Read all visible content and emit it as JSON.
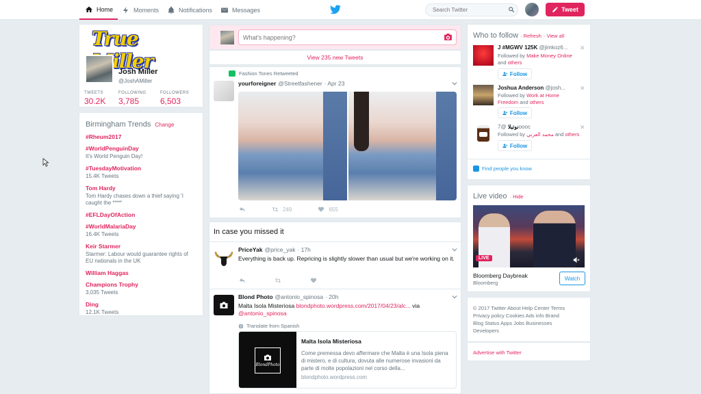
{
  "nav": {
    "home": "Home",
    "moments": "Moments",
    "notifications": "Notifications",
    "messages": "Messages",
    "search_placeholder": "Search Twitter",
    "tweet_button": "Tweet"
  },
  "profile": {
    "banner_logo": "True Miller",
    "name": "Josh Miller",
    "handle": "@JoshAMiller",
    "stats": [
      {
        "label": "TWEETS",
        "value": "30.2K"
      },
      {
        "label": "FOLLOWING",
        "value": "3,785"
      },
      {
        "label": "FOLLOWERS",
        "value": "6,503"
      }
    ]
  },
  "trends": {
    "title": "Birmingham Trends",
    "change": "Change",
    "items": [
      {
        "name": "#Rheum2017",
        "sub": ""
      },
      {
        "name": "#WorldPenguinDay",
        "sub": "It's World Penguin Day!"
      },
      {
        "name": "#TuesdayMotivation",
        "sub": "15.4K Tweets"
      },
      {
        "name": "Tom Hardy",
        "sub": "Tom Hardy chases down a thief saying 'I caught the ****'"
      },
      {
        "name": "#EFLDayOfAction",
        "sub": ""
      },
      {
        "name": "#WorldMalariaDay",
        "sub": "16.4K Tweets"
      },
      {
        "name": "Keir Starmer",
        "sub": "Starmer: Labour would guarantee rights of EU nationals in the UK"
      },
      {
        "name": "William Haggas",
        "sub": ""
      },
      {
        "name": "Champions Trophy",
        "sub": "3,035 Tweets"
      },
      {
        "name": "Ding",
        "sub": "12.1K Tweets"
      }
    ]
  },
  "compose": {
    "placeholder": "What's happening?"
  },
  "new_tweets": "View 235 new Tweets",
  "tweet1": {
    "context": "Fashion Tones Retweeted",
    "name": "yourforeigner",
    "handle": "@Streetfashener",
    "time": "· Apr 23",
    "retweets": "249",
    "likes": "655"
  },
  "missed": {
    "title": "In case you missed it"
  },
  "tweet2": {
    "name": "PriceYak",
    "handle": "@price_yak",
    "time": "· 17h",
    "text": "Everything is back up. Repricing is slightly slower than usual but we're working on it."
  },
  "tweet3": {
    "name": "Blond Photo",
    "handle": "@antonio_spinosa",
    "time": "· 20h",
    "text_before": "Malta Isola Misteriosa ",
    "link": "blondphoto.wordpress.com/2017/04/23/alc...",
    "text_via": " via",
    "mention": "@antonio_spinosa",
    "translate": "Translate from Spanish",
    "card_title": "Malta Isola Misteriosa",
    "card_text": "Come premessa devo affermare che Malta è una Isola piena di mistero, e di cultura, dovuta alle numerose invasioni da parte di molte popolazioni nel corso della...",
    "card_domain": "blondphoto.wordpress.com",
    "card_logo": "BlondPhoto"
  },
  "who_to_follow": {
    "title": "Who to follow",
    "refresh": "· Refresh",
    "view_all": "· View all",
    "follow_label": "Follow",
    "items": [
      {
        "name": "J #MGWV 125K",
        "handle": "@jimkoz6...",
        "followed_prefix": "Followed by ",
        "followed_by": "Make Money Online",
        "and": " and ",
        "others": "others"
      },
      {
        "name": "Joshua Anderson",
        "handle": "@josh...",
        "followed_prefix": "Followed by ",
        "followed_by": "Work at Home Freedom",
        "and": " and ",
        "others": "others"
      },
      {
        "name": "نوتيلا",
        "handle": "@7oooc",
        "followed_prefix": "Followed by ",
        "followed_by": "محمد العربي",
        "and": " and ",
        "others": "others"
      }
    ],
    "find_people": "Find people you know"
  },
  "live": {
    "title": "Live video",
    "hide": "· Hide",
    "badge": "LIVE",
    "show": "Bloomberg Daybreak",
    "channel": "Bloomberg",
    "watch": "Watch"
  },
  "footer": {
    "lines": [
      "© 2017 Twitter  About  Help Center  Terms",
      "Privacy policy  Cookies  Ads info  Brand",
      "Blog  Status  Apps  Jobs  Businesses",
      "Developers"
    ],
    "advertise": "Advertise with Twitter"
  },
  "colors": {
    "accent": "#e0245e",
    "link_blue": "#1b95e0",
    "background": "#e6ecf0"
  }
}
